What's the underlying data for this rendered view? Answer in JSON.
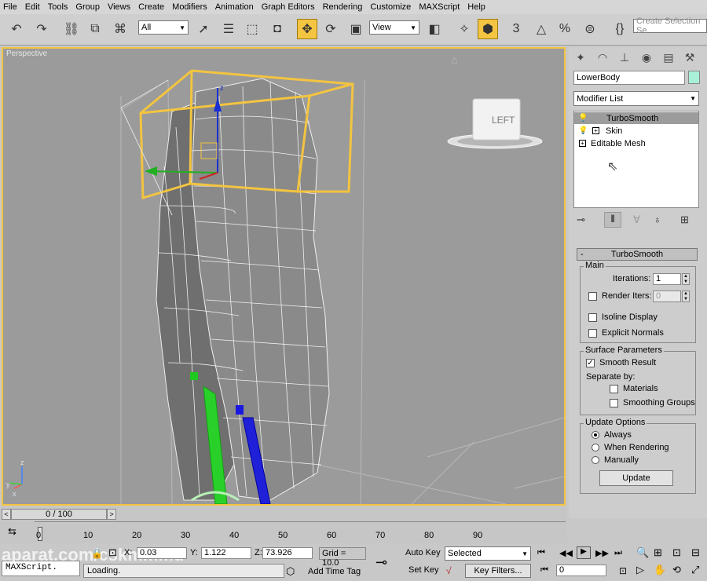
{
  "menu": [
    "File",
    "Edit",
    "Tools",
    "Group",
    "Views",
    "Create",
    "Modifiers",
    "Animation",
    "Graph Editors",
    "Rendering",
    "Customize",
    "MAXScript",
    "Help"
  ],
  "toolbar": {
    "selection_filter": "All",
    "ref_coord": "View",
    "named_selection_placeholder": "Create Selection Se",
    "snap_label": "3"
  },
  "viewport": {
    "label": "Perspective",
    "viewcube_label": "LEFT",
    "axis_z": "z",
    "axis_x": "x",
    "axis_y": "y"
  },
  "command_panel": {
    "object_name": "LowerBody",
    "object_color": "#a8f0d8",
    "modifier_list": "Modifier List",
    "stack": [
      {
        "label": "TurboSmooth",
        "selected": true,
        "expander": false
      },
      {
        "label": "Skin",
        "selected": false,
        "expander": true
      },
      {
        "label": "Editable Mesh",
        "selected": false,
        "expander": true
      }
    ],
    "rollout_collapse": "-",
    "rollout_title": "TurboSmooth",
    "main": {
      "title": "Main",
      "iterations_label": "Iterations:",
      "iterations_value": "1",
      "render_iters_label": "Render Iters:",
      "render_iters_value": "0",
      "isoline_label": "Isoline Display",
      "explicit_normals_label": "Explicit Normals"
    },
    "surface": {
      "title": "Surface Parameters",
      "smooth_result_label": "Smooth Result",
      "separate_by_label": "Separate by:",
      "materials_label": "Materials",
      "smoothing_groups_label": "Smoothing Groups"
    },
    "update": {
      "title": "Update Options",
      "always_label": "Always",
      "when_rendering_label": "When Rendering",
      "manually_label": "Manually",
      "update_button": "Update"
    }
  },
  "time": {
    "slider_label": "0 / 100",
    "ticks": [
      "0",
      "10",
      "20",
      "30",
      "40",
      "50",
      "60",
      "70",
      "80",
      "90"
    ]
  },
  "status": {
    "maxscript_label": "MAXScript.",
    "loading_text": "Loading.",
    "x_prefix": "X:",
    "x_value": "0.03",
    "y_prefix": "Y:",
    "y_value": "1.122",
    "z_prefix": "Z:",
    "z_value": "73.926",
    "grid": "Grid = 10.0",
    "add_time_tag": "Add Time Tag",
    "auto_key": "Auto Key",
    "set_key": "Set Key",
    "key_mode": "Selected",
    "key_filters": "Key Filters...",
    "frame_value": "0",
    "watermark": "aparat.com/cskmmmd"
  }
}
